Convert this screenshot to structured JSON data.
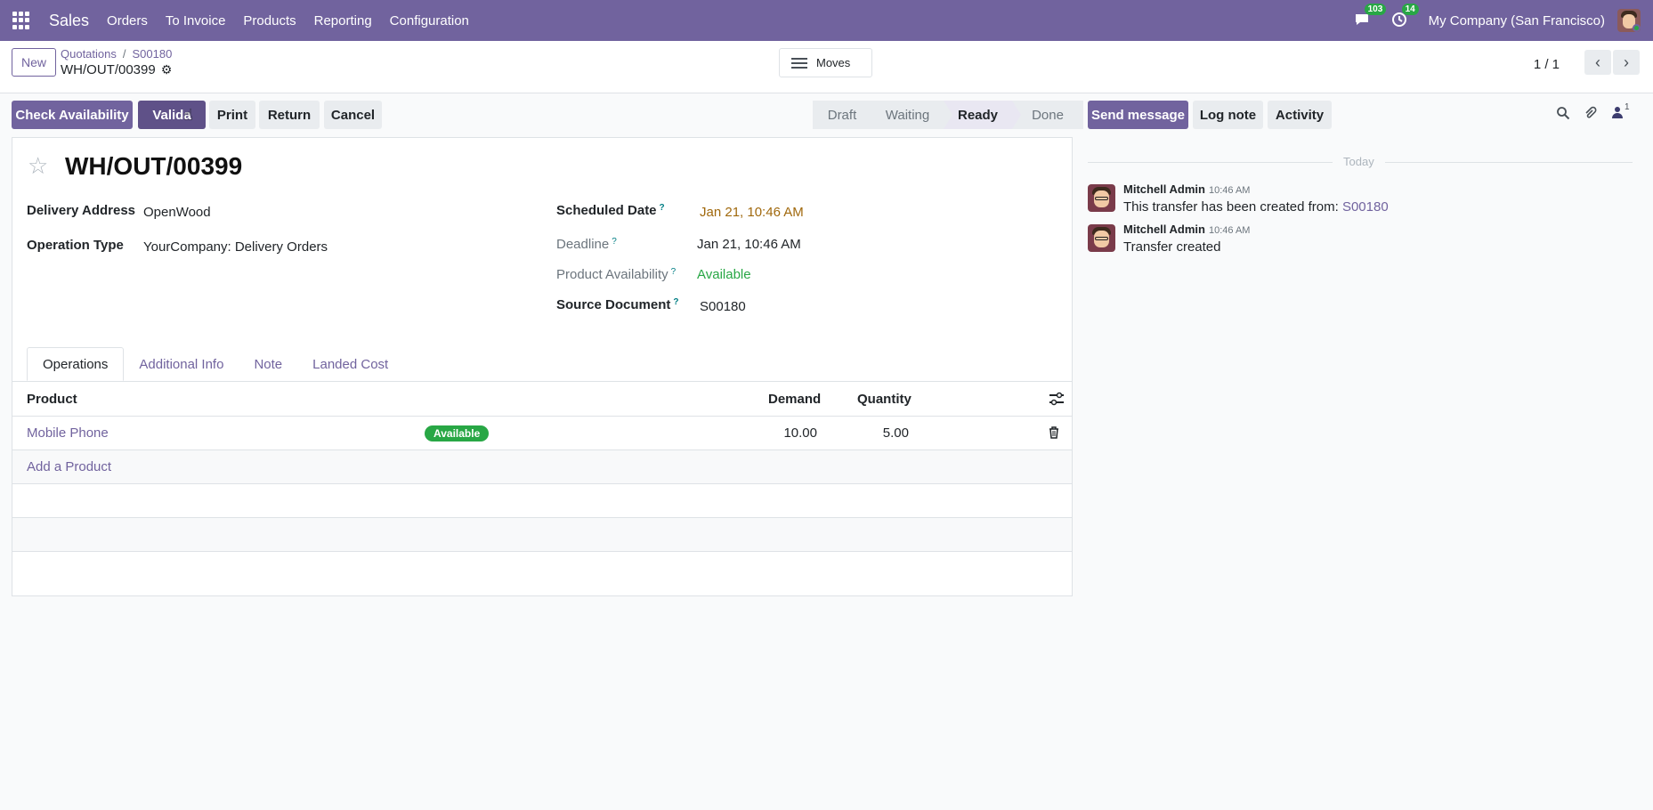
{
  "navbar": {
    "app_name": "Sales",
    "menu": [
      "Orders",
      "To Invoice",
      "Products",
      "Reporting",
      "Configuration"
    ],
    "messages_count": "103",
    "activities_count": "14",
    "company": "My Company (San Francisco)"
  },
  "control_panel": {
    "new_label": "New",
    "breadcrumb": [
      "Quotations",
      "S00180"
    ],
    "record_name": "WH/OUT/00399",
    "moves_label": "Moves",
    "pager": "1 / 1"
  },
  "actions": {
    "check_availability": "Check Availability",
    "validate": "Valida",
    "print": "Print",
    "return": "Return",
    "cancel": "Cancel"
  },
  "stages": [
    "Draft",
    "Waiting",
    "Ready",
    "Done"
  ],
  "active_stage": "Ready",
  "form": {
    "title": "WH/OUT/00399",
    "delivery_address_label": "Delivery Address",
    "delivery_address": "OpenWood",
    "operation_type_label": "Operation Type",
    "operation_type": "YourCompany: Delivery Orders",
    "scheduled_date_label": "Scheduled Date",
    "scheduled_date": "Jan 21, 10:46 AM",
    "deadline_label": "Deadline",
    "deadline": "Jan 21, 10:46 AM",
    "product_availability_label": "Product Availability",
    "product_availability": "Available",
    "source_document_label": "Source Document",
    "source_document": "S00180",
    "help_marker": "?"
  },
  "tabs": [
    "Operations",
    "Additional Info",
    "Note",
    "Landed Cost"
  ],
  "table": {
    "columns": [
      "Product",
      "Demand",
      "Quantity"
    ],
    "rows": [
      {
        "product": "Mobile Phone",
        "status": "Available",
        "demand": "10.00",
        "quantity": "5.00"
      }
    ],
    "add_line": "Add a Product"
  },
  "chatter": {
    "send_message": "Send message",
    "log_note": "Log note",
    "activity": "Activity",
    "followers_count": "1",
    "date_separator": "Today",
    "messages": [
      {
        "author": "Mitchell Admin",
        "time": "10:46 AM",
        "text": "This transfer has been created from:",
        "link": "S00180"
      },
      {
        "author": "Mitchell Admin",
        "time": "10:46 AM",
        "text": "Transfer created"
      }
    ]
  },
  "colors": {
    "brand": "#71639e",
    "success": "#28a745",
    "warning_text": "#a0680c"
  }
}
